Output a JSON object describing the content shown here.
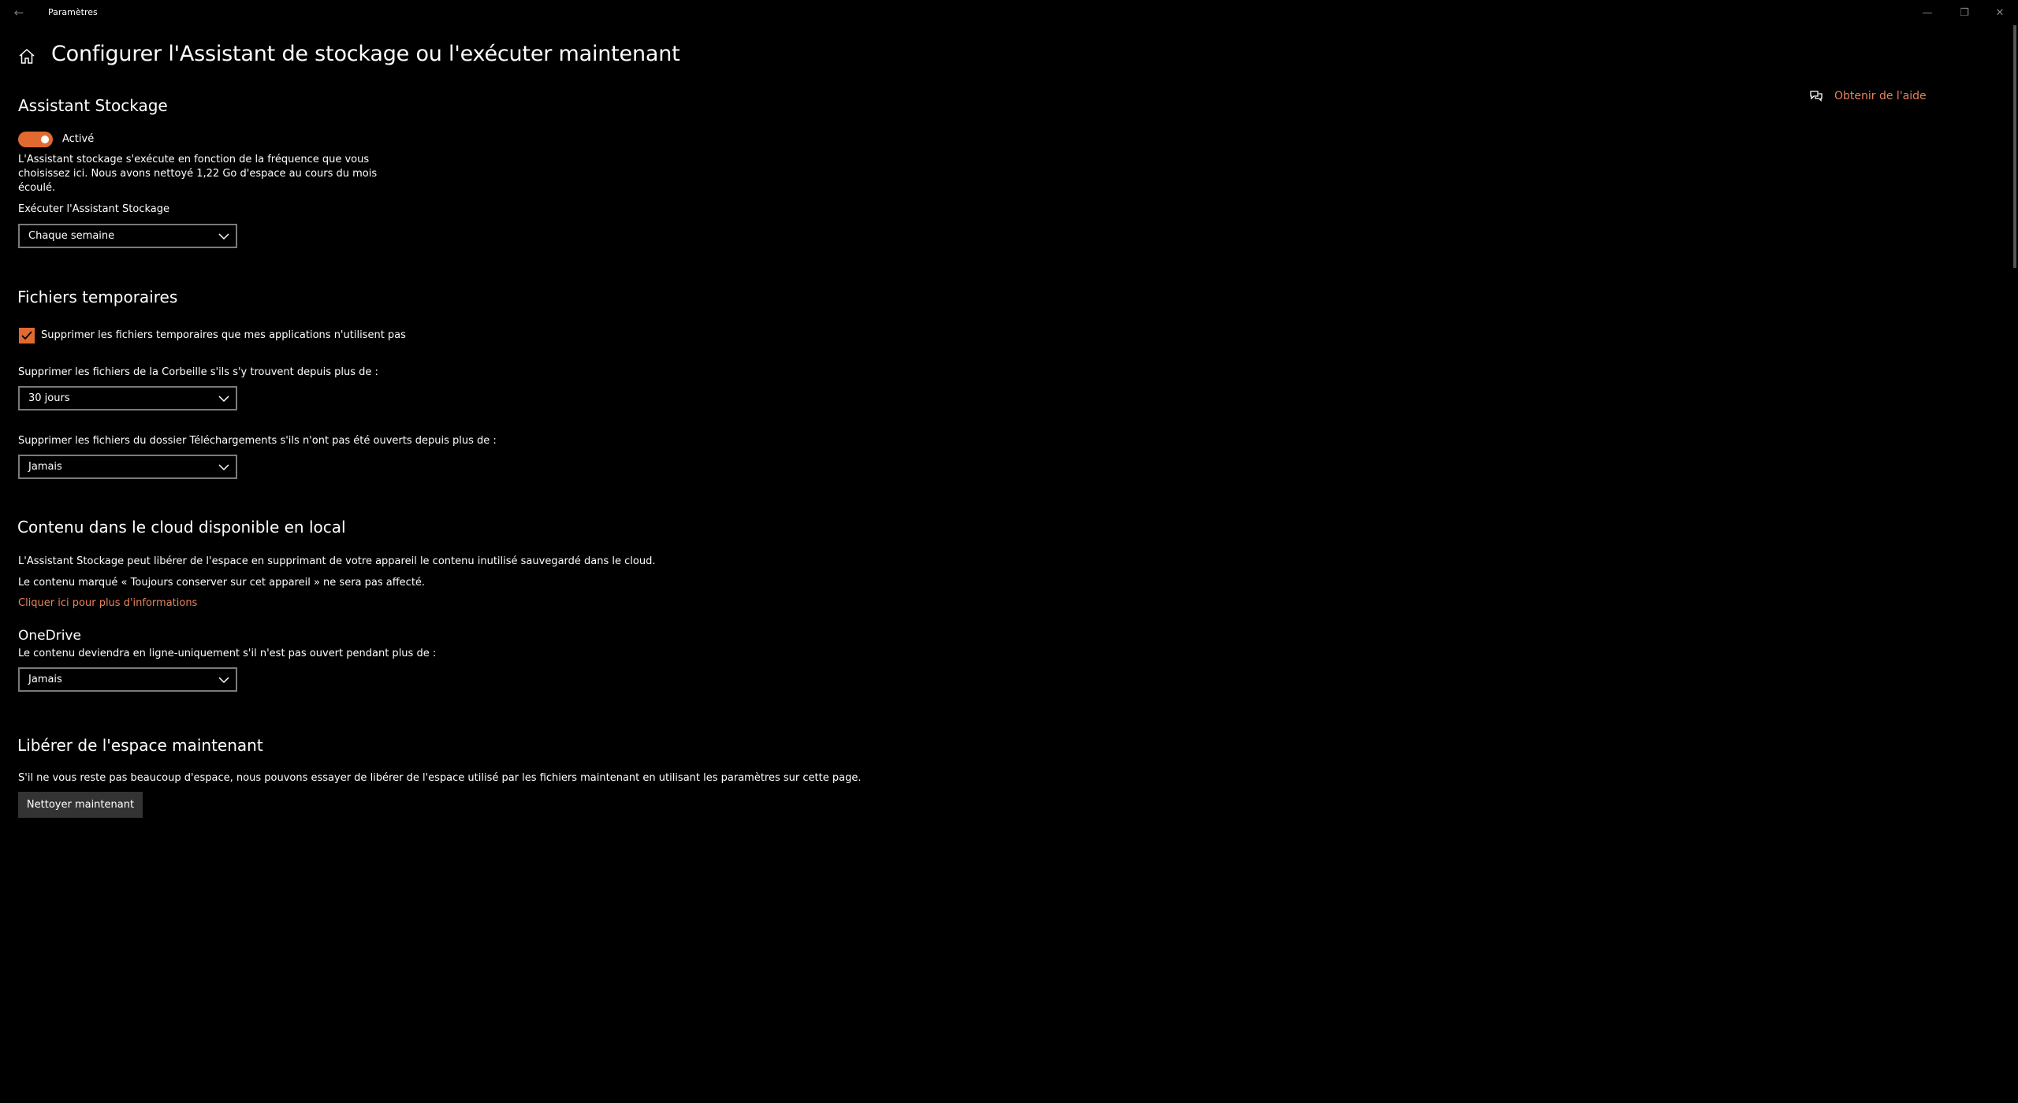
{
  "window": {
    "title": "Paramètres",
    "controls": {
      "minimize": "—",
      "restore": "❐",
      "close": "✕"
    }
  },
  "header": {
    "title": "Configurer l'Assistant de stockage ou l'exécuter maintenant",
    "help_label": "Obtenir de l'aide"
  },
  "storage_sense": {
    "heading": "Assistant Stockage",
    "toggle_state": "Activé",
    "description_line1": "L'Assistant stockage s'exécute en fonction de la fréquence que vous",
    "description_line2": "choisissez ici. Nous avons nettoyé 1,22 Go d'espace au cours du mois",
    "description_line3": "écoulé.",
    "run_label": "Exécuter l'Assistant Stockage",
    "run_value": "Chaque semaine"
  },
  "temp_files": {
    "heading": "Fichiers temporaires",
    "checkbox_label": "Supprimer les fichiers temporaires que mes applications n'utilisent pas",
    "checkbox_checked": true,
    "recycle_label": "Supprimer les fichiers de la Corbeille s'ils s'y trouvent depuis plus de :",
    "recycle_value": "30 jours",
    "downloads_label": "Supprimer les fichiers du dossier Téléchargements s'ils n'ont pas été ouverts depuis plus de :",
    "downloads_value": "Jamais"
  },
  "cloud": {
    "heading": "Contenu dans le cloud disponible en local",
    "line1": "L'Assistant Stockage peut libérer de l'espace en supprimant de votre appareil le contenu inutilisé sauvegardé dans le cloud.",
    "line2": "Le contenu marqué « Toujours conserver sur cet appareil » ne sera pas affecté.",
    "more_info_link": "Cliquer ici pour plus d'informations",
    "onedrive_title": "OneDrive",
    "onedrive_label": "Le contenu deviendra en ligne-uniquement s'il n'est pas ouvert pendant plus de :",
    "onedrive_value": "Jamais"
  },
  "free_space": {
    "heading": "Libérer de l'espace maintenant",
    "description": "S'il ne vous reste pas beaucoup d'espace, nous pouvons essayer de libérer de l'espace utilisé par les fichiers maintenant en utilisant les paramètres sur cette page.",
    "button_label": "Nettoyer maintenant"
  },
  "colors": {
    "accent": "#e06a30",
    "link": "#e8825a",
    "background": "#000000"
  }
}
